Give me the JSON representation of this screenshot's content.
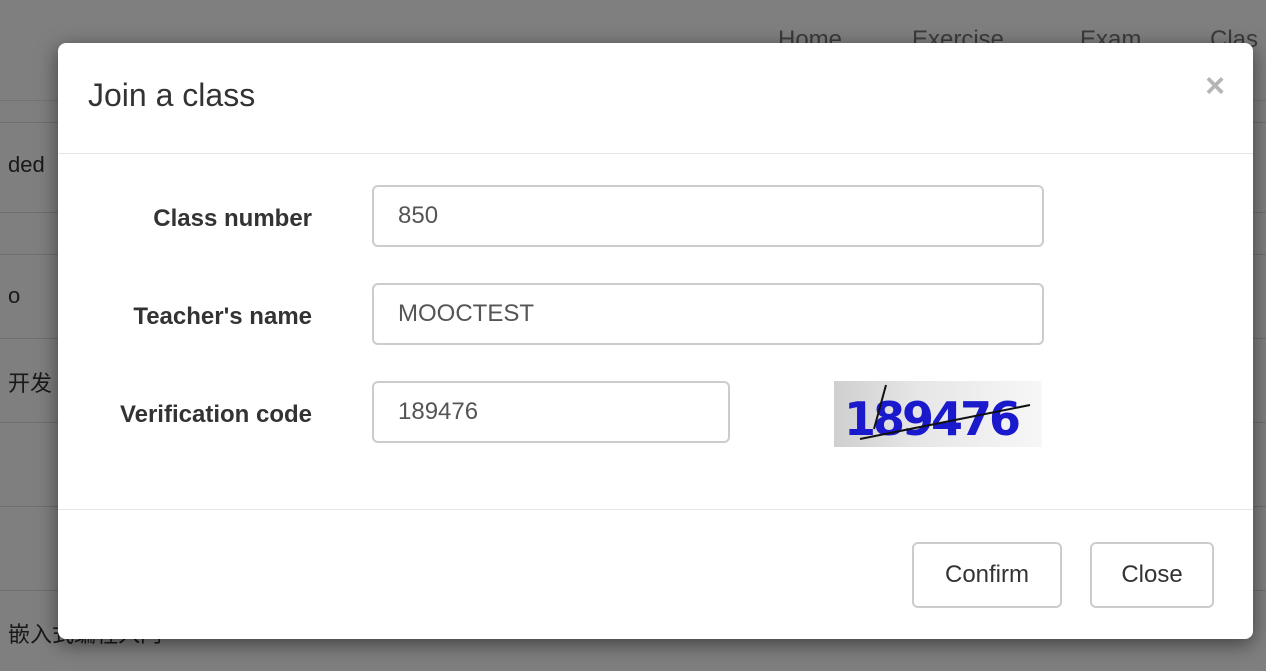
{
  "background": {
    "nav": [
      "Home",
      "Exercise",
      "Exam",
      "Clas"
    ],
    "row_texts": [
      "ded",
      "o",
      "开发",
      "嵌入式编程入门"
    ]
  },
  "modal": {
    "title": "Join a class",
    "close_symbol": "×",
    "fields": [
      {
        "label": "Class number",
        "value": "850"
      },
      {
        "label": "Teacher's name",
        "value": "MOOCTEST"
      },
      {
        "label": "Verification code",
        "value": "189476"
      }
    ],
    "captcha_text": "189476",
    "confirm_label": "Confirm",
    "close_label": "Close"
  },
  "colors": {
    "overlay": "rgba(0,0,0,0.5)",
    "captcha_text": "#1a1acc",
    "label_text": "#333333",
    "input_border": "#cccccc"
  }
}
